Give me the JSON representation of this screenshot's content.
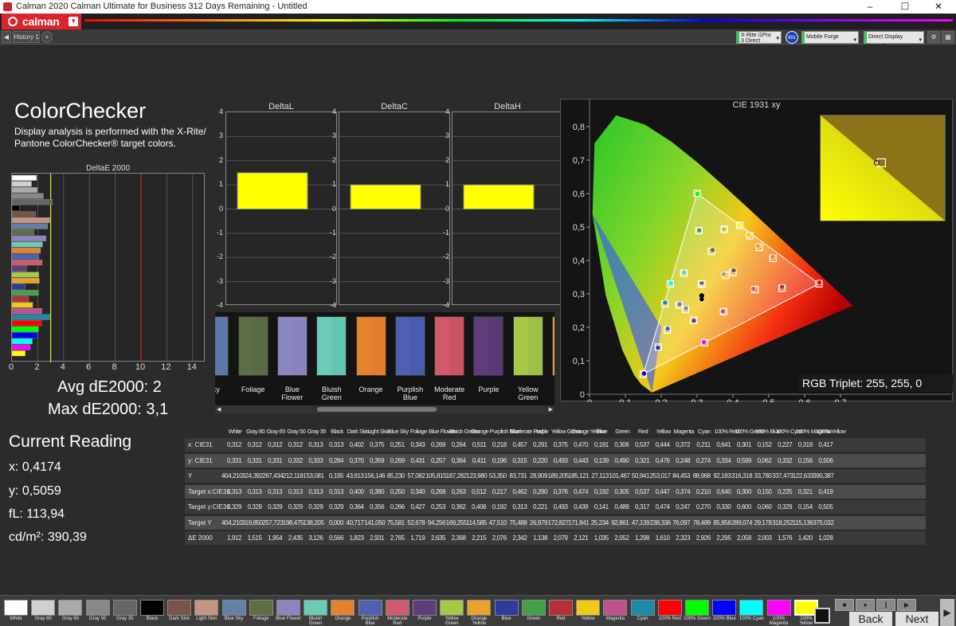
{
  "window": {
    "title": "Calman 2020 Calman Ultimate for Business 312 Days Remaining - Untitled",
    "min": "–",
    "max": "☐",
    "close": "✕"
  },
  "app": {
    "logo": "calman"
  },
  "tabs": {
    "history": "History 1",
    "add": "+"
  },
  "devices": {
    "meter": "X-Rite i1Pro 3 Direct View",
    "meter_badge": "991",
    "display": "Mobile Forge",
    "control": "Direct Display Control"
  },
  "colorchecker": {
    "title": "ColorChecker",
    "desc": "Display analysis is performed with the X-Rite/ Pantone ColorChecker® target colors."
  },
  "deltae_chart": {
    "title": "DeltaE 2000",
    "ticks": [
      "0",
      "2",
      "4",
      "6",
      "8",
      "10",
      "12",
      "14"
    ]
  },
  "summary": {
    "avg": "Avg dE2000: 2",
    "max": "Max dE2000: 3,1"
  },
  "current": {
    "title": "Current Reading",
    "x": "x: 0,4174",
    "y": "y: 0,5059",
    "fl": "fL: 113,94",
    "cd": "cd/m²: 390,39"
  },
  "delta_panels": [
    {
      "title": "DeltaL",
      "ticks": [
        "4",
        "3",
        "2",
        "1",
        "0",
        "-1",
        "-2",
        "-3",
        "-4"
      ]
    },
    {
      "title": "DeltaC",
      "ticks": [
        "4",
        "3",
        "2",
        "1",
        "0",
        "-1",
        "-2",
        "-3",
        "-4"
      ]
    },
    {
      "title": "DeltaH",
      "ticks": [
        "4",
        "3",
        "2",
        "1",
        "0",
        "-1",
        "-2",
        "-3",
        "-4"
      ]
    }
  ],
  "swatches": [
    {
      "label": "Sky",
      "color": "#6280a8",
      "tcolor": "#5a78a8"
    },
    {
      "label": "Foliage",
      "color": "#5d6e43",
      "tcolor": "#5a6a44"
    },
    {
      "label": "Blue Flower",
      "color": "#8a86c0",
      "tcolor": "#8a84be"
    },
    {
      "label": "Bluish Green",
      "color": "#6ccbb8",
      "tcolor": "#66c4b2"
    },
    {
      "label": "Orange",
      "color": "#e4832c",
      "tcolor": "#e27e2e"
    },
    {
      "label": "Purplish Blue",
      "color": "#4f60b2",
      "tcolor": "#4a5cae"
    },
    {
      "label": "Moderate Red",
      "color": "#cf5a6c",
      "tcolor": "#c85466"
    },
    {
      "label": "Purple",
      "color": "#5f3c7a",
      "tcolor": "#5a3a74"
    },
    {
      "label": "Yellow Green",
      "color": "#a8c84a",
      "tcolor": "#9cc046"
    },
    {
      "label": "",
      "color": "#e8a22e",
      "tcolor": "#e29c2c"
    }
  ],
  "cie": {
    "title": "CIE 1931 xy",
    "rgb_triplet": "RGB Triplet: 255, 255, 0",
    "xticks": [
      "0",
      "0,1",
      "0,2",
      "0,3",
      "0,4",
      "0,5",
      "0,6",
      "0,7"
    ],
    "yticks": [
      "0,8",
      "0,7",
      "0,6",
      "0,5",
      "0,4",
      "0,3",
      "0,2",
      "0,1",
      "0"
    ]
  },
  "table": {
    "columns": [
      "White",
      "Gray 80",
      "Gray 65",
      "Gray 50",
      "Gray 35",
      "Black",
      "Dark Skin",
      "Light Skin",
      "Blue Sky",
      "Foliage",
      "Blue Flower",
      "Bluish Green",
      "Orange",
      "Purplish Blue",
      "Moderate Red",
      "Purple",
      "Yellow Green",
      "Orange Yellow",
      "Blue",
      "Green",
      "Red",
      "Yellow",
      "Magenta",
      "Cyan",
      "100% Red",
      "100% Green",
      "100% Blue",
      "100% Cyan",
      "100% Magenta",
      "100% Yellow"
    ],
    "rows": [
      {
        "label": "x: CIE31",
        "cells": [
          "0,312",
          "0,312",
          "0,312",
          "0,312",
          "0,313",
          "0,313",
          "0,402",
          "0,375",
          "0,251",
          "0,343",
          "0,269",
          "0,264",
          "0,511",
          "0,218",
          "0,457",
          "0,291",
          "0,375",
          "0,470",
          "0,191",
          "0,306",
          "0,537",
          "0,444",
          "0,372",
          "0,211",
          "0,641",
          "0,301",
          "0,152",
          "0,227",
          "0,319",
          "0,417"
        ]
      },
      {
        "label": "y: CIE31",
        "cells": [
          "0,331",
          "0,331",
          "0,331",
          "0,332",
          "0,333",
          "0,284",
          "0,370",
          "0,359",
          "0,269",
          "0,431",
          "0,257",
          "0,364",
          "0,411",
          "0,196",
          "0,315",
          "0,220",
          "0,493",
          "0,443",
          "0,139",
          "0,490",
          "0,321",
          "0,476",
          "0,248",
          "0,274",
          "0,334",
          "0,599",
          "0,062",
          "0,332",
          "0,156",
          "0,506"
        ]
      },
      {
        "label": "Y",
        "cells": [
          "404,210",
          "324,392",
          "267,434",
          "212,118",
          "153,081",
          "0,195",
          "43,913",
          "156,146",
          "85,230",
          "57,082",
          "105,815",
          "187,282",
          "123,980",
          "53,350",
          "83,731",
          "28,909",
          "189,205",
          "185,121",
          "27,113",
          "101,467",
          "50,941",
          "253,017",
          "84,453",
          "88,968",
          "92,183",
          "316,318",
          "33,780",
          "337,473",
          "122,633",
          "390,387"
        ]
      },
      {
        "label": "Target x:CIE31",
        "cells": [
          "0,313",
          "0,313",
          "0,313",
          "0,313",
          "0,313",
          "0,313",
          "0,400",
          "0,380",
          "0,250",
          "0,340",
          "0,268",
          "0,263",
          "0,512",
          "0,217",
          "0,462",
          "0,290",
          "0,376",
          "0,474",
          "0,192",
          "0,305",
          "0,537",
          "0,447",
          "0,374",
          "0,210",
          "0,640",
          "0,300",
          "0,150",
          "0,225",
          "0,321",
          "0,419"
        ]
      },
      {
        "label": "Target y:CIE31",
        "cells": [
          "0,329",
          "0,329",
          "0,329",
          "0,329",
          "0,329",
          "0,329",
          "0,364",
          "0,356",
          "0,266",
          "0,427",
          "0,253",
          "0,362",
          "0,406",
          "0,192",
          "0,313",
          "0,221",
          "0,493",
          "0,439",
          "0,141",
          "0,489",
          "0,317",
          "0,474",
          "0,247",
          "0,270",
          "0,330",
          "0,600",
          "0,060",
          "0,329",
          "0,154",
          "0,505"
        ]
      },
      {
        "label": "Target Y",
        "cells": [
          "404,210",
          "319,850",
          "257,723",
          "198,475",
          "138,205",
          "0,000",
          "40,717",
          "141,050",
          "75,581",
          "52,678",
          "94,256",
          "169,255",
          "114,585",
          "47,510",
          "75,488",
          "26,979",
          "172,827",
          "171,841",
          "25,234",
          "92,861",
          "47,139",
          "238,336",
          "76,097",
          "78,489",
          "85,958",
          "289,074",
          "29,178",
          "318,252",
          "115,136",
          "375,032"
        ]
      },
      {
        "label": "ΔE 2000",
        "cells": [
          "1,912",
          "1,515",
          "1,954",
          "2,435",
          "3,126",
          "0,566",
          "1,823",
          "2,931",
          "2,765",
          "1,719",
          "2,635",
          "2,368",
          "2,215",
          "2,076",
          "2,342",
          "1,138",
          "2,079",
          "2,121",
          "1,035",
          "2,052",
          "1,298",
          "1,610",
          "2,323",
          "2,926",
          "2,295",
          "2,058",
          "2,003",
          "1,576",
          "1,420",
          "1,028"
        ]
      }
    ]
  },
  "bottom_swatches": [
    {
      "label": "White",
      "color": "#ffffff"
    },
    {
      "label": "Gray 80",
      "color": "#d0d0d0"
    },
    {
      "label": "Gray 65",
      "color": "#aaaaaa"
    },
    {
      "label": "Gray 50",
      "color": "#888888"
    },
    {
      "label": "Gray 35",
      "color": "#666666"
    },
    {
      "label": "Black",
      "color": "#000000"
    },
    {
      "label": "Dark Skin",
      "color": "#7a5446"
    },
    {
      "label": "Light Skin",
      "color": "#c49582"
    },
    {
      "label": "Blue Sky",
      "color": "#6280a8"
    },
    {
      "label": "Foliage",
      "color": "#5d6e43"
    },
    {
      "label": "Blue Flower",
      "color": "#8a86c0"
    },
    {
      "label": "Bluish Green",
      "color": "#6ccbb8"
    },
    {
      "label": "Orange",
      "color": "#e4832c"
    },
    {
      "label": "Purplish Blue",
      "color": "#4f60b2"
    },
    {
      "label": "Moderate Red",
      "color": "#cf5a6c"
    },
    {
      "label": "Purple",
      "color": "#5f3c7a"
    },
    {
      "label": "Yellow Green",
      "color": "#a8c84a"
    },
    {
      "label": "Orange Yellow",
      "color": "#e8a22e"
    },
    {
      "label": "Blue",
      "color": "#2c3c9a"
    },
    {
      "label": "Green",
      "color": "#45a04a"
    },
    {
      "label": "Red",
      "color": "#b82e36"
    },
    {
      "label": "Yellow",
      "color": "#f0ca1a"
    },
    {
      "label": "Magenta",
      "color": "#c0508e"
    },
    {
      "label": "Cyan",
      "color": "#1e8aa8"
    },
    {
      "label": "100% Red",
      "color": "#ff0000"
    },
    {
      "label": "100% Green",
      "color": "#00ff00"
    },
    {
      "label": "100% Blue",
      "color": "#0000ff"
    },
    {
      "label": "100% Cyan",
      "color": "#00ffff"
    },
    {
      "label": "100% Magenta",
      "color": "#ff00ff"
    },
    {
      "label": "100% Yellow",
      "color": "#ffff00"
    }
  ],
  "nav": {
    "back": "Back",
    "next": "Next"
  },
  "colors": {
    "accent": "#d9252b",
    "yellow": "#ffff00",
    "background": "#2b2b2b"
  }
}
